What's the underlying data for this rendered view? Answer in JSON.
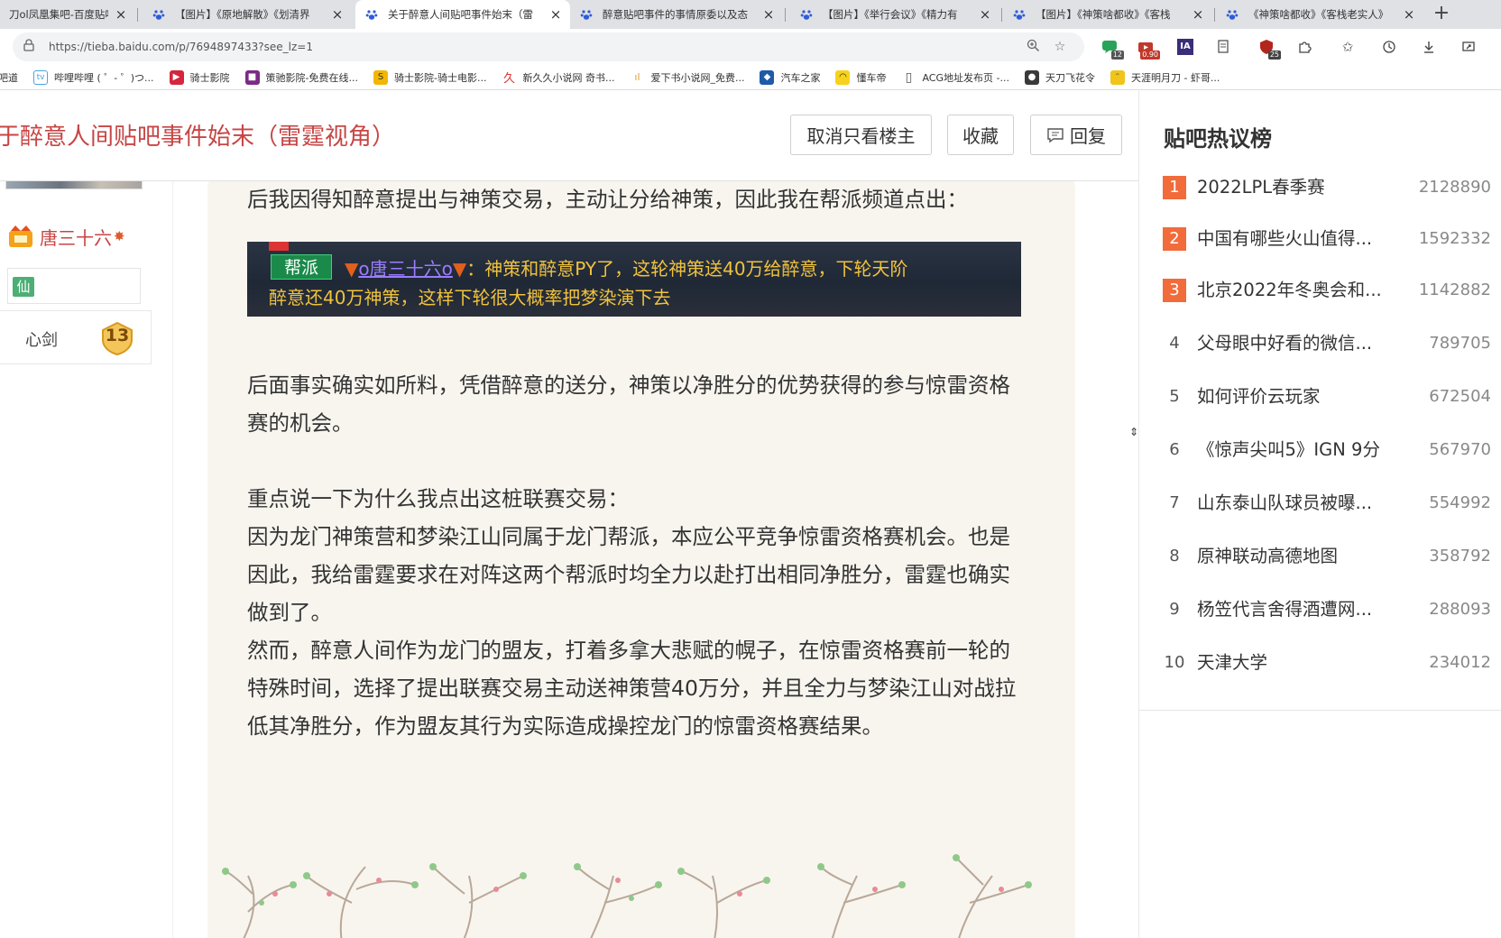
{
  "tabs": [
    {
      "title": "刀ol凤凰集吧-百度贴吧",
      "active": false
    },
    {
      "title": "【图片】《原地解散》《划清界",
      "active": false
    },
    {
      "title": "关于醉意人间贴吧事件始末（雷",
      "active": true
    },
    {
      "title": "醉意贴吧事件的事情原委以及态",
      "active": false
    },
    {
      "title": "【图片】《举行会议》《精力有",
      "active": false
    },
    {
      "title": "【图片】《神策啥都收》《客栈",
      "active": false
    },
    {
      "title": "《神策啥都收》《客栈老实人》",
      "active": false
    }
  ],
  "address": {
    "url": "https://tieba.baidu.com/p/7694897433?see_lz=1"
  },
  "extensions": {
    "badge1": "12",
    "badge2": "0.90",
    "badge3": "25",
    "ia_label": "IA"
  },
  "bookmarks": [
    {
      "label": "吧道"
    },
    {
      "label": "哔哩哔哩 ( ゜- ゜)つ..."
    },
    {
      "label": "骑士影院"
    },
    {
      "label": "策驰影院-免费在线..."
    },
    {
      "label": "骑士影院-骑士电影..."
    },
    {
      "label": "新久久小说网 奇书..."
    },
    {
      "label": "爱下书小说网_免费..."
    },
    {
      "label": "汽车之家"
    },
    {
      "label": "懂车帝"
    },
    {
      "label": "ACG地址发布页 -..."
    },
    {
      "label": "天刀飞花令"
    },
    {
      "label": "天涯明月刀 - 虾哥..."
    }
  ],
  "thread": {
    "title": "于醉意人间贴吧事件始末（雷霆视角）",
    "buttons": {
      "only_op": "取消只看楼主",
      "favorite": "收藏",
      "reply": "回复"
    }
  },
  "author": {
    "name": "唐三十六",
    "xian": "仙",
    "level_name": "心剑",
    "level": "13"
  },
  "post": {
    "p1": "后我因得知醉意提出与神策交易，主动让分给神策，因此我在帮派频道点出：",
    "screenshot": {
      "tag": "帮派",
      "player": "o唐三十六o",
      "line1_rest": "：神策和醉意PY了，这轮神策送40万给醉意，下轮天阶",
      "line2": "醉意还40万神策，这样下轮很大概率把梦染演下去"
    },
    "p2": "后面事实确实如所料，凭借醉意的送分，神策以净胜分的优势获得的参与惊雷资格赛的机会。",
    "p3_heading": "重点说一下为什么我点出这桩联赛交易：",
    "p3": "因为龙门神策营和梦染江山同属于龙门帮派，本应公平竞争惊雷资格赛机会。也是因此，我给雷霆要求在对阵这两个帮派时均全力以赴打出相同净胜分，雷霆也确实做到了。",
    "p4": "然而，醉意人间作为龙门的盟友，打着多拿大悲赋的幌子，在惊雷资格赛前一轮的特殊时间，选择了提出联赛交易主动送神策营40万分，并且全力与梦染江山对战拉低其净胜分，作为盟友其行为实际造成操控龙门的惊雷资格赛结果。"
  },
  "hot_list": {
    "title": "贴吧热议榜",
    "items": [
      {
        "rank": "1",
        "name": "2022LPL春季赛",
        "count": "2128890"
      },
      {
        "rank": "2",
        "name": "中国有哪些火山值得...",
        "count": "1592332"
      },
      {
        "rank": "3",
        "name": "北京2022年冬奥会和...",
        "count": "1142882"
      },
      {
        "rank": "4",
        "name": "父母眼中好看的微信...",
        "count": "789705"
      },
      {
        "rank": "5",
        "name": "如何评价云玩家",
        "count": "672504"
      },
      {
        "rank": "6",
        "name": "《惊声尖叫5》IGN 9分",
        "count": "567970"
      },
      {
        "rank": "7",
        "name": "山东泰山队球员被曝...",
        "count": "554992"
      },
      {
        "rank": "8",
        "name": "原神联动高德地图",
        "count": "358792"
      },
      {
        "rank": "9",
        "name": "杨笠代言舍得酒遭网...",
        "count": "288093"
      },
      {
        "rank": "10",
        "name": "天津大学",
        "count": "234012"
      }
    ]
  },
  "colors": {
    "title_red": "#c74545",
    "hot_rank": "#f26b3a",
    "card_bg": "#f8f5ef"
  }
}
